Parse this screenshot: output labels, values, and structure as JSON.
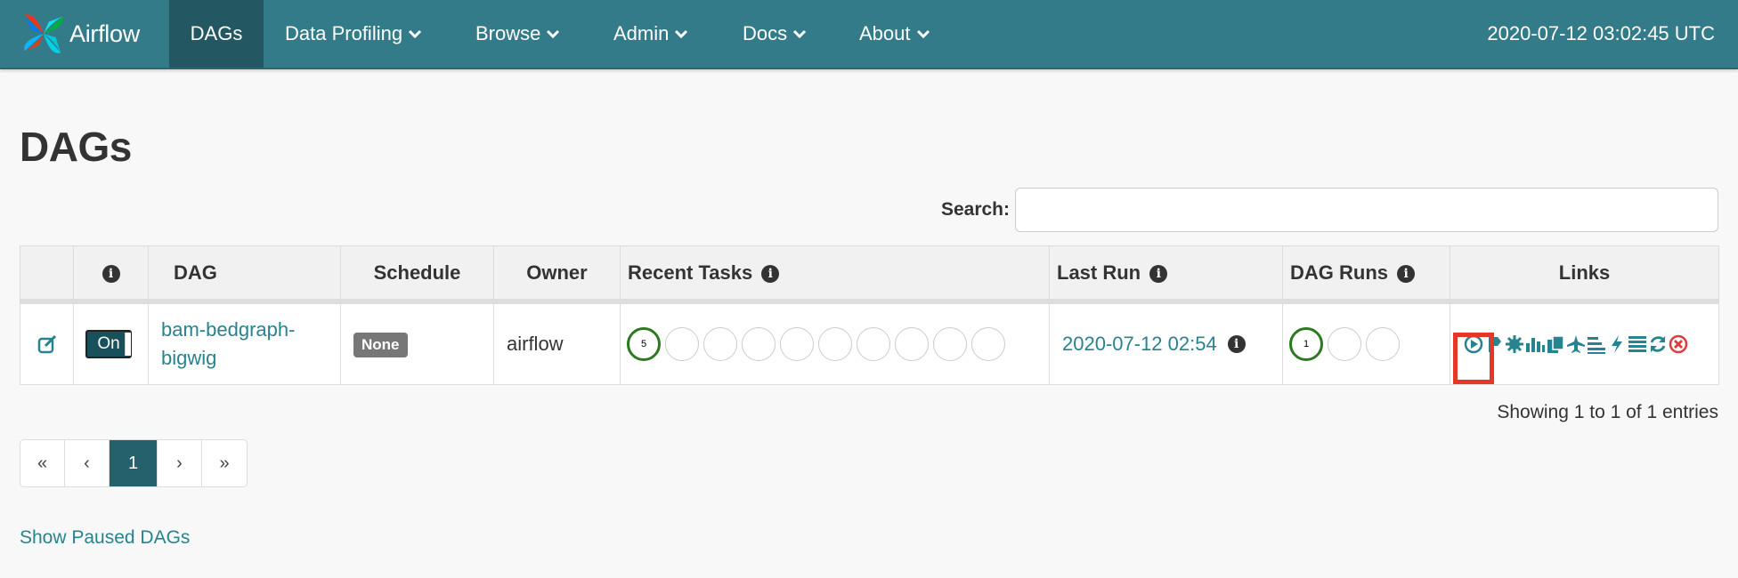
{
  "nav": {
    "brand": "Airflow",
    "items": [
      {
        "label": "DAGs"
      },
      {
        "label": "Data Profiling"
      },
      {
        "label": "Browse"
      },
      {
        "label": "Admin"
      },
      {
        "label": "Docs"
      },
      {
        "label": "About"
      }
    ],
    "time": "2020-07-12 03:02:45 UTC"
  },
  "page": {
    "title": "DAGs",
    "search_label": "Search:",
    "search_value": ""
  },
  "table": {
    "headers": {
      "dag": "DAG",
      "schedule": "Schedule",
      "owner": "Owner",
      "recent_tasks": "Recent Tasks",
      "last_run": "Last Run",
      "dag_runs": "DAG Runs",
      "links": "Links"
    },
    "rows": [
      {
        "toggle": "On",
        "dag_line1": "bam-bedgraph-",
        "dag_line2": "bigwig",
        "schedule": "None",
        "owner": "airflow",
        "recent_tasks_success": "5",
        "last_run": "2020-07-12 02:54",
        "dag_runs_success": "1"
      }
    ]
  },
  "footer": {
    "showing": "Showing 1 to 1 of 1 entries",
    "pagination": [
      "«",
      "‹",
      "1",
      "›",
      "»"
    ],
    "paused_link": "Show Paused DAGs"
  },
  "colors": {
    "navbar": "#337b89",
    "active_nav": "#235863",
    "link": "#26838f",
    "success": "#2b7a1f",
    "highlight": "#e53725",
    "delete": "#e03a3a"
  },
  "icons": [
    "airflow-logo-icon",
    "chevron-down-icon",
    "info-icon",
    "edit-icon",
    "trigger-dag-icon",
    "tree-view-icon",
    "graph-view-icon",
    "task-duration-icon",
    "task-tries-icon",
    "landing-times-icon",
    "gantt-icon",
    "code-view-icon",
    "logs-icon",
    "refresh-icon",
    "delete-icon"
  ]
}
